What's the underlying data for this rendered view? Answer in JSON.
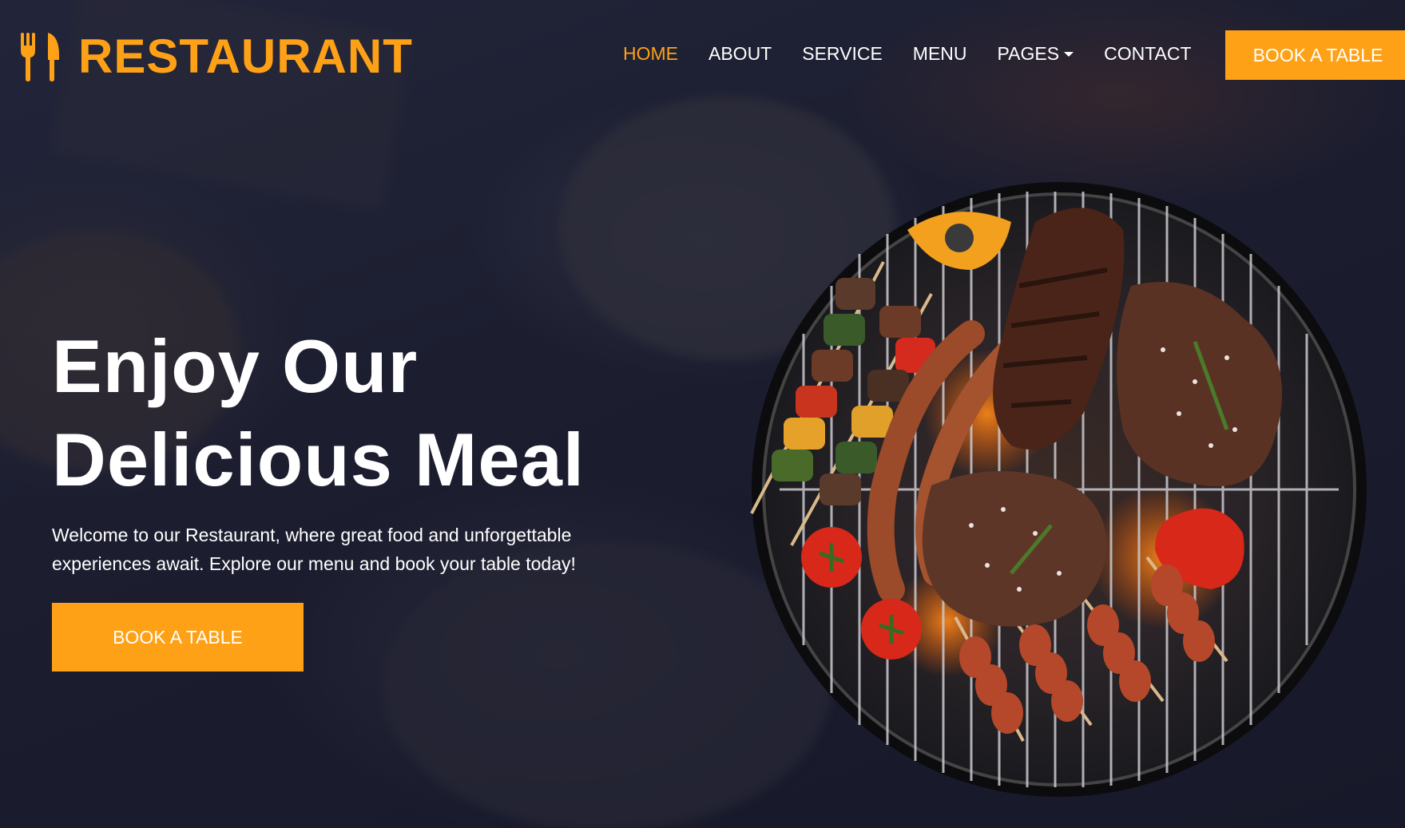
{
  "brand": {
    "name": "RESTAURANT",
    "icon": "utensils-icon"
  },
  "nav": {
    "items": [
      {
        "label": "HOME",
        "active": true
      },
      {
        "label": "ABOUT"
      },
      {
        "label": "SERVICE"
      },
      {
        "label": "MENU"
      },
      {
        "label": "PAGES",
        "dropdown": true
      },
      {
        "label": "CONTACT"
      }
    ],
    "cta_label": "BOOK A TABLE"
  },
  "hero": {
    "headline_line1": "Enjoy Our",
    "headline_line2": "Delicious Meal",
    "subtitle": "Welcome to our Restaurant, where great food and unforgettable experiences await. Explore our menu and book your table today!",
    "cta_label": "BOOK A TABLE",
    "image": "bbq-grill-image"
  },
  "colors": {
    "accent": "#fea116",
    "background": "#1c1e30",
    "text": "#ffffff"
  }
}
